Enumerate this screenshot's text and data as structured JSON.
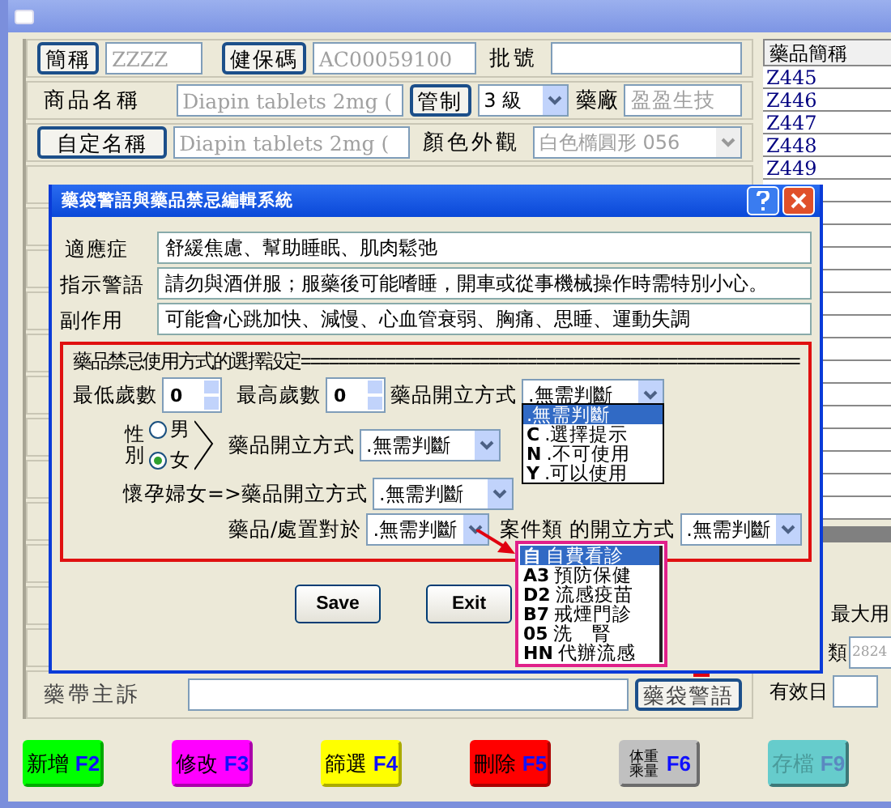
{
  "form": {
    "short_name_button": "簡稱",
    "short_name": "ZZZZ",
    "nhi_code_button": "健保碼",
    "nhi_code": "AC00059100",
    "batch_label": "批號",
    "product_name_label": "商品名稱",
    "product_name": "Diapin tablets 2mg (",
    "control_button": "管制",
    "control_level": "3 級",
    "manufacturer_label": "藥廠",
    "manufacturer": "盈盈生技",
    "custom_name_button": "自定名稱",
    "custom_name": "Diapin tablets 2mg (",
    "appearance_label": "顏色外觀",
    "appearance": "白色橢圓形 056",
    "complaint_label": "藥帶主訴",
    "warning_button": "藥袋警語"
  },
  "drug_list": {
    "header": "藥品簡稱",
    "items": [
      "Z445",
      "Z446",
      "Z447",
      "Z448",
      "Z449"
    ]
  },
  "side_fields": {
    "max_label": "最大用",
    "category_label": "類",
    "category_value": "2824",
    "expiry_label": "有效日"
  },
  "function_buttons": [
    {
      "label": "新增",
      "key": "F2",
      "color": "#00ff00",
      "disabled": false
    },
    {
      "label": "修改",
      "key": "F3",
      "color": "#ff00ff",
      "disabled": false
    },
    {
      "label": "篩選",
      "key": "F4",
      "color": "#ffff00",
      "disabled": false
    },
    {
      "label": "刪除",
      "key": "F5",
      "color": "#ff0000",
      "disabled": false
    },
    {
      "label": "体重乘量",
      "key": "F6",
      "color": "#c0c0c0",
      "disabled": false
    },
    {
      "label": "存檔",
      "key": "F9",
      "color": "#66cccc",
      "disabled": true
    }
  ],
  "dialog": {
    "title": "藥袋警語與藥品禁忌編輯系統",
    "fields": [
      {
        "label": "適應症",
        "value": "舒緩焦慮、幫助睡眠、肌肉鬆弛"
      },
      {
        "label": "指示警語",
        "value": "請勿與酒併服；服藥後可能嗜睡，開車或從事機械操作時需特別小心。"
      },
      {
        "label": "副作用",
        "value": "可能會心跳加快、減慢、心血管衰弱、胸痛、思睡、運動失調"
      }
    ],
    "rules": {
      "heading": "藥品禁忌使用方式的選擇設定=====================================================",
      "min_age_label": "最低歲數",
      "min_age": "0",
      "max_age_label": "最高歲數",
      "max_age": "0",
      "age_method_label": "藥品開立方式",
      "age_method": ".無需判斷",
      "sex_label": "性別",
      "sex_options": [
        {
          "label": "男",
          "selected": false
        },
        {
          "label": "女",
          "selected": true
        }
      ],
      "sex_method_label": "藥品開立方式",
      "sex_method": ".無需判斷",
      "pregnant_label": "懷孕婦女=>藥品開立方式",
      "pregnant_method": ".無需判斷",
      "treatment_label": "藥品/處置對於",
      "treatment_value": ".無需判斷",
      "case_label": "案件類 的開立方式",
      "case_method": ".無需判斷"
    },
    "method_options": [
      {
        "text": ".無需判斷",
        "selected": true
      },
      {
        "code": "C",
        "text": ".選擇提示",
        "selected": false
      },
      {
        "code": "N",
        "text": ".不可使用",
        "selected": false
      },
      {
        "code": "Y",
        "text": ".可以使用",
        "selected": false
      }
    ],
    "case_options": [
      {
        "code": "自",
        "text": "自費看診",
        "selected": true
      },
      {
        "code": "A3",
        "text": "預防保健",
        "selected": false
      },
      {
        "code": "D2",
        "text": "流感疫苗",
        "selected": false
      },
      {
        "code": "B7",
        "text": "戒煙門診",
        "selected": false
      },
      {
        "code": "05",
        "text": "洗　腎",
        "selected": false
      },
      {
        "code": "HN",
        "text": "代辦流感",
        "selected": false
      }
    ],
    "buttons": [
      "Save",
      "Exit"
    ]
  }
}
